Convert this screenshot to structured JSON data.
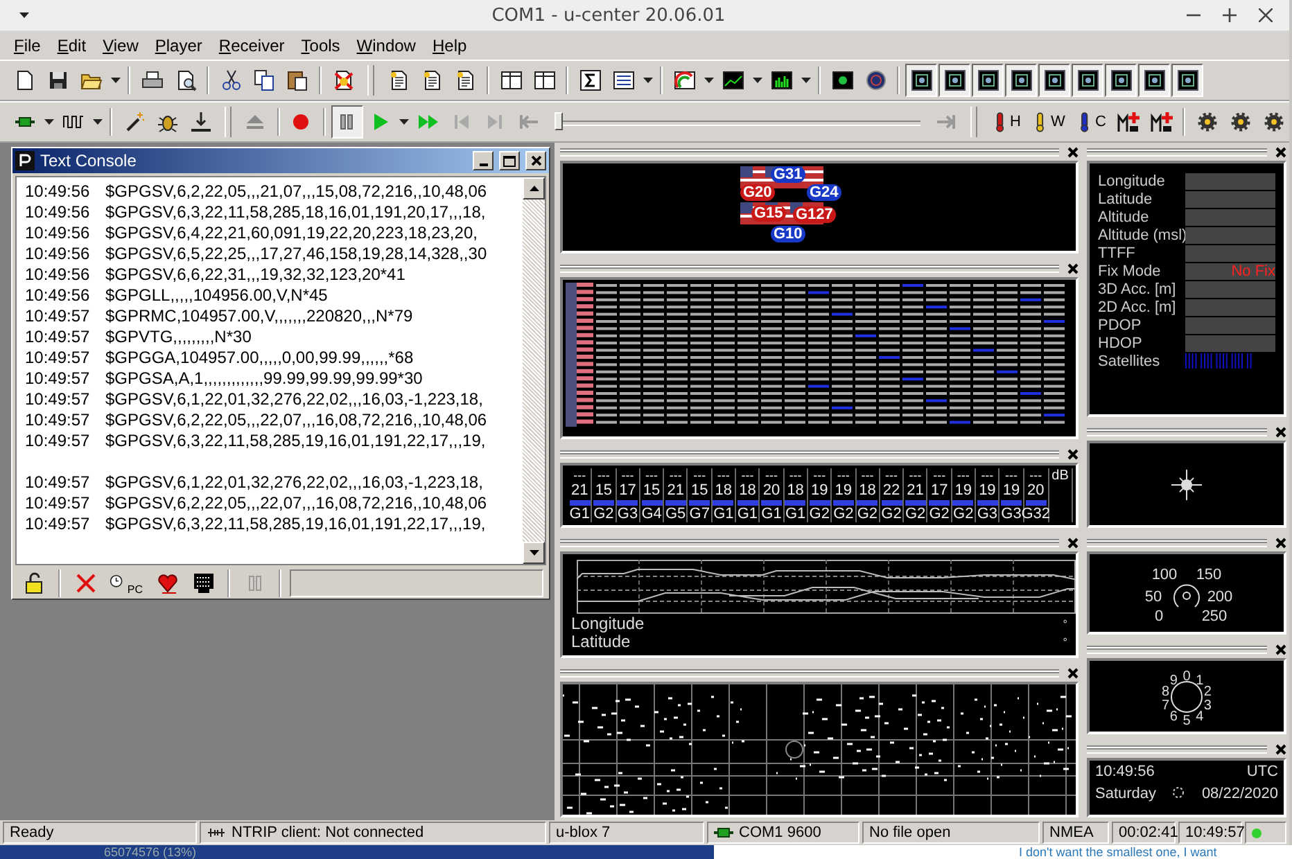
{
  "window": {
    "title": "COM1 - u-center 20.06.01"
  },
  "menu": [
    "File",
    "Edit",
    "View",
    "Player",
    "Receiver",
    "Tools",
    "Window",
    "Help"
  ],
  "toolbar_1": [
    {
      "kind": "new-document",
      "pressed": false
    },
    {
      "kind": "save",
      "pressed": false
    },
    {
      "kind": "folder",
      "pressed": false
    },
    {
      "kind": "caret",
      "pressed": false
    },
    {
      "kind": "separator"
    },
    {
      "kind": "printer",
      "pressed": false
    },
    {
      "kind": "print-preview",
      "pressed": false
    },
    {
      "kind": "separator"
    },
    {
      "kind": "scissors",
      "pressed": false
    },
    {
      "kind": "copy",
      "pressed": false
    },
    {
      "kind": "paste",
      "pressed": false
    },
    {
      "kind": "separator"
    },
    {
      "kind": "blocked-document",
      "pressed": false
    },
    {
      "kind": "grip"
    },
    {
      "kind": "document",
      "pressed": false
    },
    {
      "kind": "document",
      "pressed": false
    },
    {
      "kind": "document",
      "pressed": false
    },
    {
      "kind": "separator"
    },
    {
      "kind": "panel",
      "pressed": false
    },
    {
      "kind": "panel",
      "pressed": false
    },
    {
      "kind": "separator"
    },
    {
      "kind": "sigma",
      "pressed": false
    },
    {
      "kind": "list",
      "pressed": false
    },
    {
      "kind": "caret",
      "pressed": false
    },
    {
      "kind": "separator"
    },
    {
      "kind": "color-chart",
      "pressed": false
    },
    {
      "kind": "caret",
      "pressed": false
    },
    {
      "kind": "line-chart",
      "pressed": false
    },
    {
      "kind": "caret",
      "pressed": false
    },
    {
      "kind": "bar-chart",
      "pressed": false
    },
    {
      "kind": "caret",
      "pressed": false
    },
    {
      "kind": "separator"
    },
    {
      "kind": "screen",
      "pressed": false
    },
    {
      "kind": "globe",
      "pressed": false
    },
    {
      "kind": "separator"
    },
    {
      "kind": "window",
      "pressed": true
    },
    {
      "kind": "window",
      "pressed": true
    },
    {
      "kind": "window",
      "pressed": true
    },
    {
      "kind": "window",
      "pressed": true
    },
    {
      "kind": "window",
      "pressed": true
    },
    {
      "kind": "window",
      "pressed": true
    },
    {
      "kind": "window",
      "pressed": true
    },
    {
      "kind": "window",
      "pressed": true
    },
    {
      "kind": "window",
      "pressed": true
    }
  ],
  "toolbar_2": [
    {
      "kind": "plug",
      "pressed": false
    },
    {
      "kind": "caret",
      "pressed": false
    },
    {
      "kind": "wave",
      "pressed": false
    },
    {
      "kind": "caret",
      "pressed": false
    },
    {
      "kind": "separator"
    },
    {
      "kind": "wand",
      "pressed": false
    },
    {
      "kind": "bug",
      "pressed": false
    },
    {
      "kind": "download",
      "pressed": false
    },
    {
      "kind": "grip"
    },
    {
      "kind": "eject",
      "pressed": false
    },
    {
      "kind": "separator"
    },
    {
      "kind": "record",
      "pressed": false
    },
    {
      "kind": "separator"
    },
    {
      "kind": "pause",
      "pressed": true
    },
    {
      "kind": "play",
      "pressed": false
    },
    {
      "kind": "caret",
      "pressed": false
    },
    {
      "kind": "fast-forward",
      "pressed": false
    },
    {
      "kind": "step-back",
      "pressed": false
    },
    {
      "kind": "step-forward",
      "pressed": false
    },
    {
      "kind": "skip-back",
      "pressed": false
    },
    {
      "kind": "slider",
      "level": 0
    },
    {
      "kind": "skip-end",
      "pressed": false
    },
    {
      "kind": "grip"
    },
    {
      "kind": "thermometer",
      "pressed": false,
      "label": "H",
      "color": "#d01818"
    },
    {
      "kind": "thermometer",
      "pressed": false,
      "label": "W",
      "color": "#e8c020"
    },
    {
      "kind": "thermometer",
      "pressed": false,
      "label": "C",
      "color": "#2030c0"
    },
    {
      "kind": "memory-plus",
      "pressed": false
    },
    {
      "kind": "memory-plus",
      "pressed": false
    },
    {
      "kind": "separator"
    },
    {
      "kind": "gear",
      "pressed": false
    },
    {
      "kind": "gear",
      "pressed": false
    },
    {
      "kind": "gear",
      "pressed": false
    }
  ],
  "text_console": {
    "title": "Text Console",
    "lines": [
      {
        "kind": "line",
        "time": "10:49:56",
        "text": "$GPGSV,6,2,22,05,,,21,07,,,15,08,72,216,,10,48,06"
      },
      {
        "kind": "line",
        "time": "10:49:56",
        "text": "$GPGSV,6,3,22,11,58,285,18,16,01,191,20,17,,,18,"
      },
      {
        "kind": "line",
        "time": "10:49:56",
        "text": "$GPGSV,6,4,22,21,60,091,19,22,20,223,18,23,20,"
      },
      {
        "kind": "line",
        "time": "10:49:56",
        "text": "$GPGSV,6,5,22,25,,,17,27,46,158,19,28,14,328,,30"
      },
      {
        "kind": "line",
        "time": "10:49:56",
        "text": "$GPGSV,6,6,22,31,,,19,32,32,123,20*41"
      },
      {
        "kind": "line",
        "time": "10:49:56",
        "text": "$GPGLL,,,,,104956.00,V,N*45"
      },
      {
        "kind": "line",
        "time": "10:49:57",
        "text": "$GPRMC,104957.00,V,,,,,,,220820,,,N*79"
      },
      {
        "kind": "line",
        "time": "10:49:57",
        "text": "$GPVTG,,,,,,,,,N*30"
      },
      {
        "kind": "line",
        "time": "10:49:57",
        "text": "$GPGGA,104957.00,,,,,0,00,99.99,,,,,,*68"
      },
      {
        "kind": "line",
        "time": "10:49:57",
        "text": "$GPGSA,A,1,,,,,,,,,,,,,99.99,99.99,99.99*30"
      },
      {
        "kind": "line",
        "time": "10:49:57",
        "text": "$GPGSV,6,1,22,01,32,276,22,02,,,16,03,-1,223,18,"
      },
      {
        "kind": "line",
        "time": "10:49:57",
        "text": "$GPGSV,6,2,22,05,,,22,07,,,16,08,72,216,,10,48,06"
      },
      {
        "kind": "line",
        "time": "10:49:57",
        "text": "$GPGSV,6,3,22,11,58,285,19,16,01,191,22,17,,,19,"
      },
      {
        "kind": "gap"
      },
      {
        "kind": "line",
        "time": "10:49:57",
        "text": "$GPGSV,6,1,22,01,32,276,22,02,,,16,03,-1,223,18,"
      },
      {
        "kind": "line",
        "time": "10:49:57",
        "text": "$GPGSV,6,2,22,05,,,22,07,,,16,08,72,216,,10,48,06"
      },
      {
        "kind": "line",
        "time": "10:49:57",
        "text": "$GPGSV,6,3,22,11,58,285,19,16,01,191,22,17,,,19,"
      }
    ],
    "toolbar": [
      {
        "kind": "lock"
      },
      {
        "kind": "separator"
      },
      {
        "kind": "cross"
      },
      {
        "kind": "clock",
        "label": "PC"
      },
      {
        "kind": "heart"
      },
      {
        "kind": "chip-screen"
      },
      {
        "kind": "separator"
      },
      {
        "kind": "pause-outline"
      },
      {
        "kind": "separator"
      }
    ]
  },
  "sky_view": {
    "satellites": [
      {
        "label": "G31",
        "color": "#1838c8"
      },
      {
        "label": "G20",
        "color": "#c81818"
      },
      {
        "label": "G24",
        "color": "#1838c8"
      },
      {
        "label": "G15",
        "color": "#c81818"
      },
      {
        "label": "G127",
        "color": "#c81818"
      },
      {
        "label": "G10",
        "color": "#1838c8"
      }
    ]
  },
  "signal_levels": {
    "unit": "dB",
    "columns": [
      {
        "header": "---",
        "value": "21",
        "label": "G1"
      },
      {
        "header": "---",
        "value": "15",
        "label": "G2"
      },
      {
        "header": "---",
        "value": "17",
        "label": "G3"
      },
      {
        "header": "---",
        "value": "15",
        "label": "G4"
      },
      {
        "header": "---",
        "value": "21",
        "label": "G5"
      },
      {
        "header": "---",
        "value": "15",
        "label": "G7"
      },
      {
        "header": "---",
        "value": "18",
        "label": "G1"
      },
      {
        "header": "---",
        "value": "18",
        "label": "G1"
      },
      {
        "header": "---",
        "value": "20",
        "label": "G1"
      },
      {
        "header": "---",
        "value": "18",
        "label": "G1"
      },
      {
        "header": "---",
        "value": "19",
        "label": "G2"
      },
      {
        "header": "---",
        "value": "19",
        "label": "G2"
      },
      {
        "header": "---",
        "value": "18",
        "label": "G2"
      },
      {
        "header": "---",
        "value": "22",
        "label": "G2"
      },
      {
        "header": "---",
        "value": "21",
        "label": "G2"
      },
      {
        "header": "---",
        "value": "17",
        "label": "G2"
      },
      {
        "header": "---",
        "value": "19",
        "label": "G2"
      },
      {
        "header": "---",
        "value": "19",
        "label": "G3"
      },
      {
        "header": "---",
        "value": "19",
        "label": "G3"
      },
      {
        "header": "---",
        "value": "20",
        "label": "G32"
      }
    ]
  },
  "position_map": {
    "rows": [
      {
        "label": "Longitude",
        "unit": "°"
      },
      {
        "label": "Latitude",
        "unit": "°"
      }
    ]
  },
  "data_view": {
    "rows": [
      {
        "kind": "field",
        "label": "Longitude"
      },
      {
        "kind": "field",
        "label": "Latitude"
      },
      {
        "kind": "field",
        "label": "Altitude"
      },
      {
        "kind": "field",
        "label": "Altitude (msl)"
      },
      {
        "kind": "field",
        "label": "TTFF"
      },
      {
        "kind": "field",
        "label": "Fix Mode",
        "value": "No Fix"
      },
      {
        "kind": "field",
        "label": "3D Acc. [m]"
      },
      {
        "kind": "field",
        "label": "2D Acc. [m]"
      },
      {
        "kind": "field",
        "label": "PDOP"
      },
      {
        "kind": "field",
        "label": "HDOP"
      },
      {
        "kind": "bars",
        "label": "Satellites"
      }
    ]
  },
  "speed_gauge": {
    "ticks": [
      "100",
      "150",
      "50",
      "200",
      "0",
      "250"
    ]
  },
  "altitude_dial": {
    "digits": [
      "9",
      "0",
      "1",
      "8",
      "2",
      "7",
      "3",
      "6",
      "5",
      "4"
    ]
  },
  "clock": {
    "time": "10:49:56",
    "zone": "UTC",
    "weekday": "Saturday",
    "date": "08/22/2020"
  },
  "status_bar": [
    {
      "kind": "text",
      "text": "Ready"
    },
    {
      "kind": "ntrip",
      "text": "NTRIP client: Not connected"
    },
    {
      "kind": "text",
      "text": "u-blox 7"
    },
    {
      "kind": "port",
      "text": "COM1 9600"
    },
    {
      "kind": "text",
      "text": "No file open"
    },
    {
      "kind": "text",
      "text": "NMEA"
    },
    {
      "kind": "text",
      "text": "00:02:41"
    },
    {
      "kind": "text",
      "text": "10:49:57"
    },
    {
      "kind": "led",
      "color": "#30d030"
    }
  ],
  "desktop": {
    "texts": [
      "65074576 (13%)",
      "I don't want the smallest one, I want"
    ]
  }
}
